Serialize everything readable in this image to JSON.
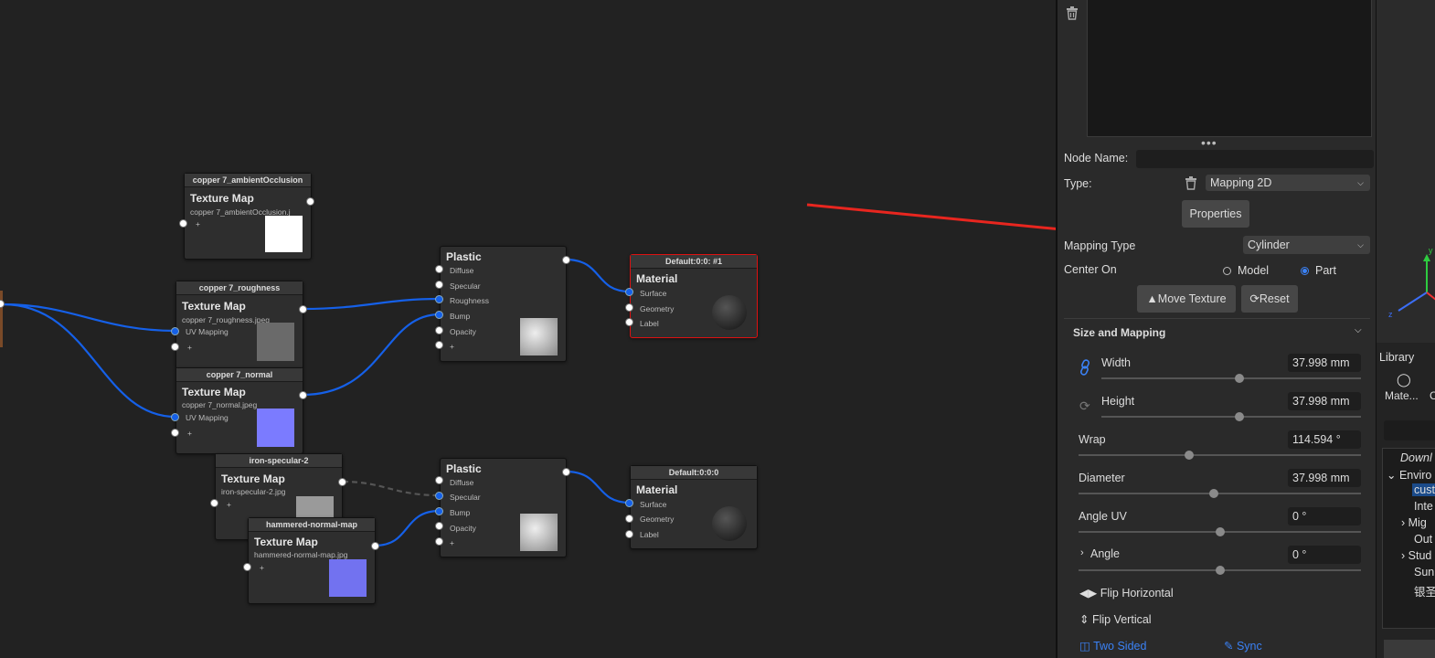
{
  "canvas": {
    "nodes": {
      "ao": {
        "header": "copper 7_ambientOcclusion",
        "title": "Texture Map",
        "file": "copper 7_ambientOcclusion.j",
        "port_plus": "+"
      },
      "rough": {
        "header": "copper 7_roughness",
        "title": "Texture Map",
        "file": "copper 7_roughness.jpeg",
        "port_uv": "UV Mapping",
        "port_plus": "+"
      },
      "normal": {
        "header": "copper 7_normal",
        "title": "Texture Map",
        "file": "copper 7_normal.jpeg",
        "port_uv": "UV Mapping",
        "port_plus": "+"
      },
      "iron": {
        "header": "iron-specular-2",
        "title": "Texture Map",
        "file": "iron-specular-2.jpg",
        "port_plus": "+"
      },
      "hammer": {
        "header": "hammered-normal-map",
        "title": "Texture Map",
        "file": "hammered-normal-map.jpg",
        "port_plus": "+"
      },
      "plastic1": {
        "title": "Plastic",
        "ports": [
          "Diffuse",
          "Specular",
          "Roughness",
          "Bump",
          "Opacity",
          "+"
        ]
      },
      "plastic2": {
        "title": "Plastic",
        "ports": [
          "Diffuse",
          "Specular",
          "Bump",
          "Opacity",
          "+"
        ]
      },
      "mat1": {
        "header": "Default:0:0: #1",
        "title": "Material",
        "ports": [
          "Surface",
          "Geometry",
          "Label"
        ]
      },
      "mat2": {
        "header": "Default:0:0:0",
        "title": "Material",
        "ports": [
          "Surface",
          "Geometry",
          "Label"
        ]
      }
    }
  },
  "panel": {
    "dots": "•••",
    "node_name_label": "Node Name:",
    "node_name_value": "",
    "type_label": "Type:",
    "type_value": "Mapping 2D",
    "properties_button": "Properties",
    "mapping_type_label": "Mapping Type",
    "mapping_type_value": "Cylinder",
    "center_on_label": "Center On",
    "center_on_options": [
      "Model",
      "Part"
    ],
    "center_on_selected": "Part",
    "move_texture_button": "Move Texture",
    "reset_button": "Reset",
    "section_title": "Size and Mapping",
    "fields": [
      {
        "label": "Width",
        "value": "37.998 mm",
        "slider": 0.53
      },
      {
        "label": "Height",
        "value": "37.998 mm",
        "slider": 0.53
      },
      {
        "label": "Wrap",
        "value": "114.594 °",
        "slider": 0.39
      },
      {
        "label": "Diameter",
        "value": "37.998 mm",
        "slider": 0.48
      },
      {
        "label": "Angle UV",
        "value": "0 °",
        "slider": 0.5
      },
      {
        "label": "Angle",
        "value": "0 °",
        "slider": 0.5
      }
    ],
    "flip_horizontal": "Flip Horizontal",
    "flip_vertical": "Flip Vertical",
    "two_sided": "Two Sided",
    "sync": "Sync"
  },
  "far": {
    "axis_y": "y",
    "axis_z": "z",
    "library_label": "Library",
    "tab_label": "Mate...",
    "tab_label2": "C",
    "tree": [
      "Downl",
      "Enviro",
      "cust",
      "Inte",
      "Mig",
      "Out",
      "Stud",
      "Sun",
      "银圣"
    ]
  },
  "colors": {
    "accent": "#3b82f6",
    "wire": "#1560e8",
    "selection": "#dd1111",
    "arrow": "#e8261f"
  }
}
